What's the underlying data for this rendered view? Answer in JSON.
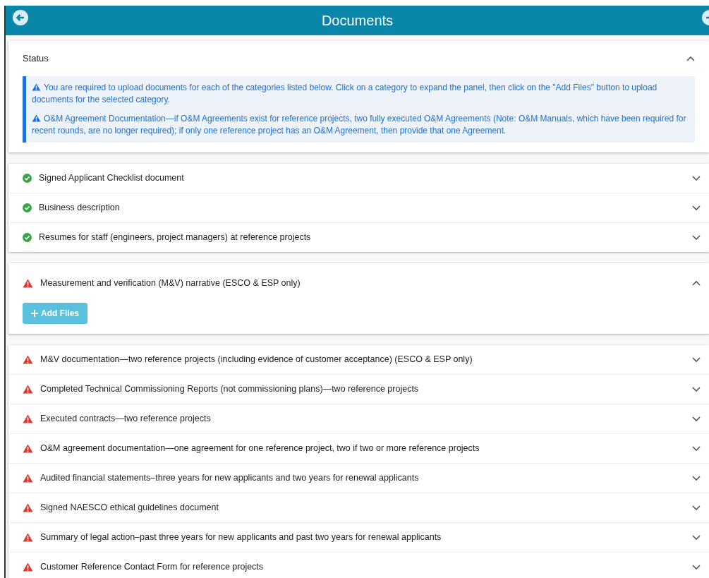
{
  "header": {
    "title": "Documents"
  },
  "status": {
    "title": "Status",
    "expanded": true,
    "notices": [
      "You are required to upload documents for each of the categories listed below. Click on a category to expand the panel, then click on the \"Add Files\" button to upload documents for the selected category.",
      "O&M Agreement Documentation—if O&M Agreements exist for reference projects, two fully executed O&M Agreements (Note: O&M Manuals, which have been required for recent rounds, are no longer required); if only one reference project has an O&M Agreement, then provide that one Agreement."
    ]
  },
  "groups": [
    {
      "items": [
        {
          "label": "Signed Applicant Checklist document",
          "kind": "complete",
          "expanded": false
        },
        {
          "label": "Business description",
          "kind": "complete",
          "expanded": false
        },
        {
          "label": "Resumes for staff (engineers, project managers) at reference projects",
          "kind": "complete",
          "expanded": false
        }
      ]
    },
    {
      "items": [
        {
          "label": "Measurement and verification (M&V) narrative (ESCO & ESP only)",
          "kind": "missing",
          "expanded": true,
          "button": "Add Files"
        }
      ]
    },
    {
      "items": [
        {
          "label": "M&V documentation—two reference projects (including evidence of customer acceptance) (ESCO & ESP only)",
          "kind": "missing",
          "expanded": false
        },
        {
          "label": "Completed Technical Commissioning Reports (not commissioning plans)—two reference projects",
          "kind": "missing",
          "expanded": false
        },
        {
          "label": "Executed contracts—two reference projects",
          "kind": "missing",
          "expanded": false
        },
        {
          "label": "O&M agreement documentation—one agreement for one reference project, two if two or more reference projects",
          "kind": "missing",
          "expanded": false
        },
        {
          "label": "Audited financial statements–three years for new applicants and two years for renewal applicants",
          "kind": "missing",
          "expanded": false
        },
        {
          "label": "Signed NAESCO ethical guidelines document",
          "kind": "missing",
          "expanded": false
        },
        {
          "label": "Summary of legal action–past three years for new applicants and past two years for renewal applicants",
          "kind": "missing",
          "expanded": false
        },
        {
          "label": "Customer Reference Contact Form for reference projects",
          "kind": "missing",
          "expanded": false
        }
      ]
    }
  ]
}
